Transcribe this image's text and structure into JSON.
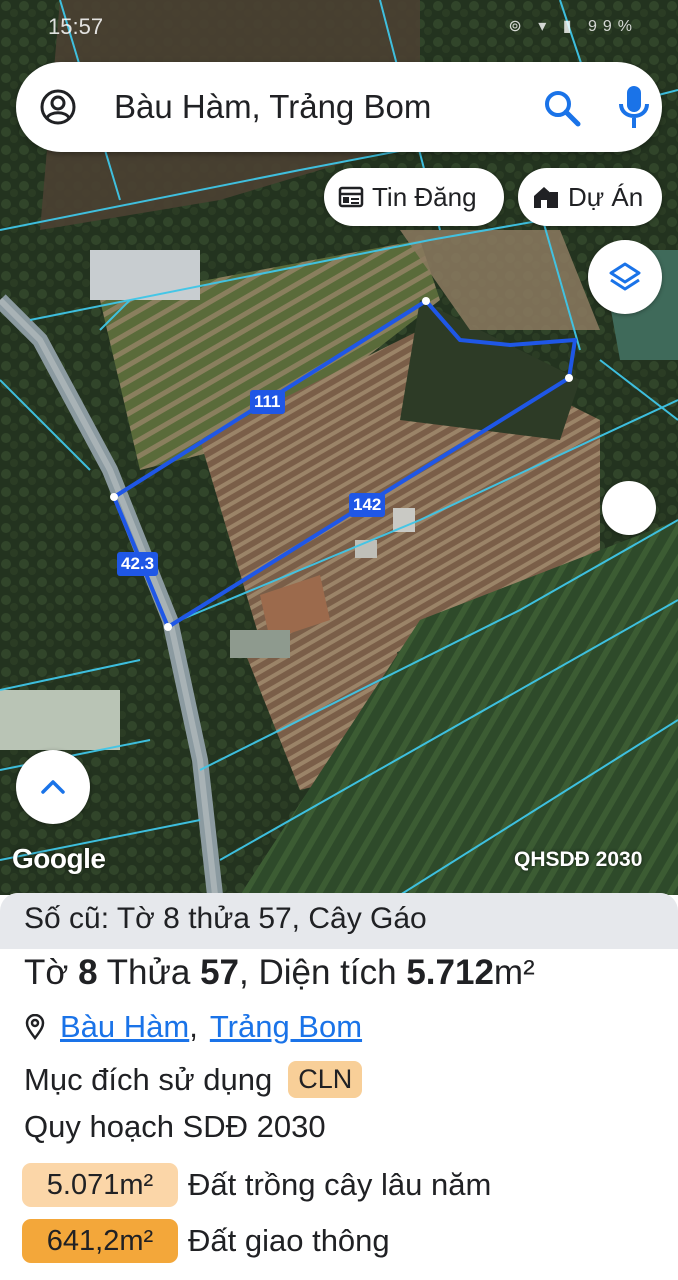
{
  "status_bar": {
    "time": "15:57",
    "icons": "⊚ ▾ ▮ 99%"
  },
  "search": {
    "query": "Bàu Hàm, Trảng Bom"
  },
  "chips": {
    "news": "Tin Đăng",
    "projects": "Dự Án"
  },
  "map": {
    "edge_labels": {
      "north": "111",
      "south": "142",
      "west": "42.3"
    },
    "attribution": "Google",
    "plan_layer": "QHSDĐ 2030"
  },
  "panel": {
    "old_ref": "Số cũ: Tờ 8 thửa 57, Cây Gáo",
    "title_prefix": "Tờ ",
    "sheet": "8",
    "title_mid1": " Thửa ",
    "parcel": "57",
    "title_mid2": ", Diện tích ",
    "area_value": "5.712",
    "area_unit": "m²",
    "location_commune": "Bàu Hàm",
    "location_sep": ",",
    "location_district": "Trảng Bom",
    "usage_label": "Mục đích sử dụng",
    "usage_code": "CLN",
    "plan_label": "Quy hoạch SDĐ 2030",
    "plan_areas": [
      {
        "area": "5.071m²",
        "use": "Đất trồng cây lâu năm",
        "color": "#fbd6a8"
      },
      {
        "area": "641,2m²",
        "use": "Đất giao thông",
        "color": "#f3a73a"
      }
    ]
  },
  "colors": {
    "parcel_outline": "#1f57e6",
    "cadastral_lines": "#3fc6e8",
    "link": "#1a73e8"
  }
}
